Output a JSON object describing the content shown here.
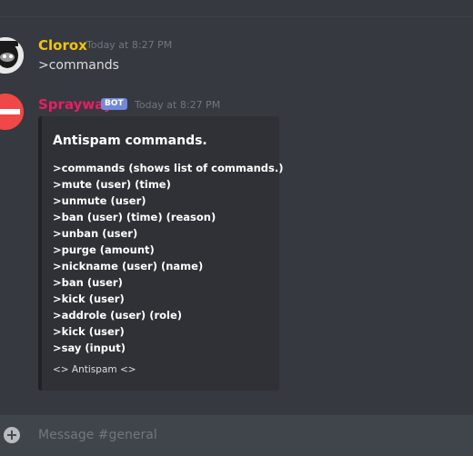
{
  "messages": [
    {
      "username": "Clorox",
      "username_color": "#f1c40f",
      "timestamp": "Today at 8:27 PM",
      "text": ">commands"
    },
    {
      "username": "Sprayway",
      "username_color": "#e91e63",
      "bot_tag": "BOT",
      "timestamp": "Today at 8:27 PM",
      "embed": {
        "title": "Antispam commands.",
        "lines": [
          ">commands (shows list of commands.)",
          ">mute (user) (time)",
          ">unmute (user)",
          ">ban (user) (time) (reason)",
          ">unban (user)",
          ">purge (amount)",
          ">nickname (user) (name)",
          ">ban (user)",
          ">kick (user)",
          ">addrole (user) (role)",
          ">kick (user)",
          ">say (input)"
        ],
        "footer": "<> Antispam <>"
      }
    }
  ],
  "input": {
    "placeholder": "Message #general",
    "plus_icon": "plus-circle-icon"
  }
}
